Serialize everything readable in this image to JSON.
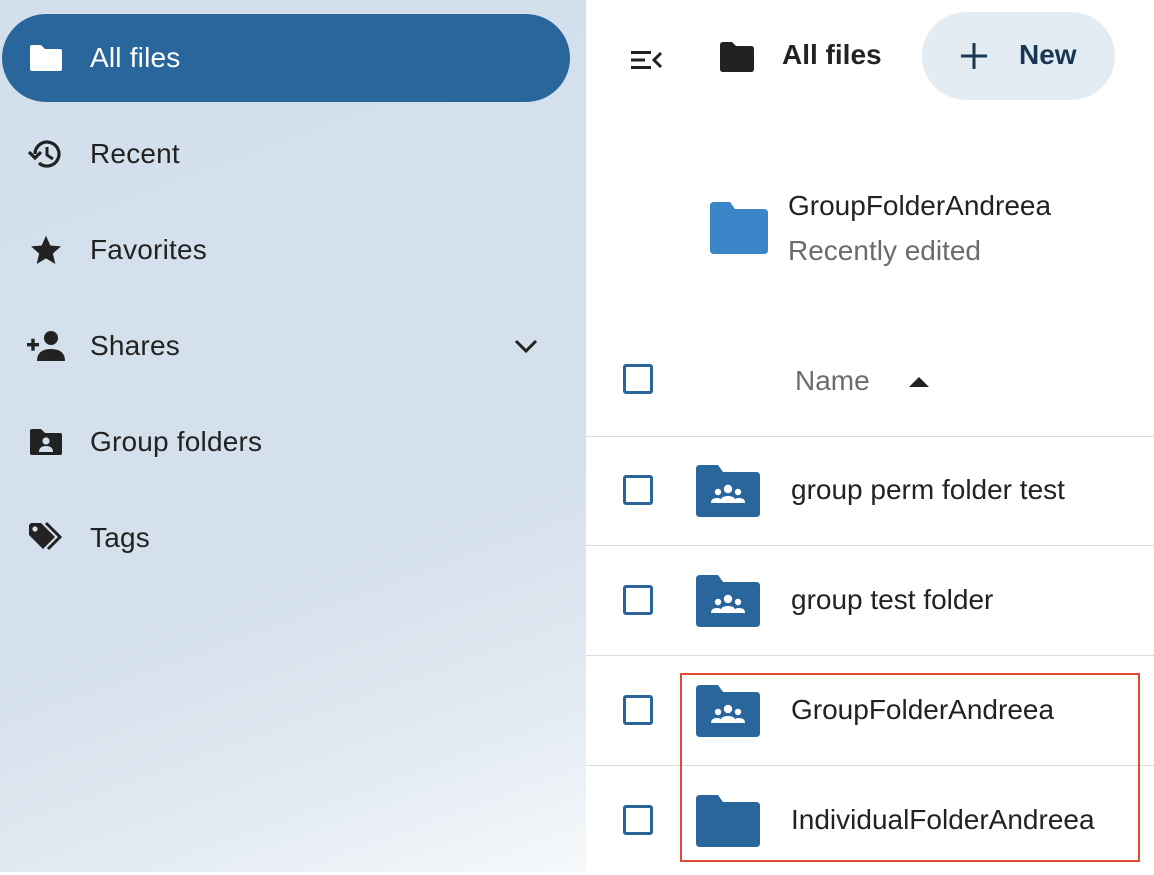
{
  "sidebar": {
    "items": [
      {
        "label": "All files",
        "icon": "folder-icon",
        "active": true
      },
      {
        "label": "Recent",
        "icon": "history-icon"
      },
      {
        "label": "Favorites",
        "icon": "star-icon"
      },
      {
        "label": "Shares",
        "icon": "share-person-icon",
        "expandable": true
      },
      {
        "label": "Group folders",
        "icon": "group-folder-icon"
      },
      {
        "label": "Tags",
        "icon": "tags-icon"
      }
    ]
  },
  "header": {
    "breadcrumb": "All files",
    "new_label": "New"
  },
  "recent": {
    "name": "GroupFolderAndreea",
    "subtitle": "Recently edited"
  },
  "table": {
    "column_name": "Name",
    "sort": "ascending",
    "rows": [
      {
        "name": "group perm folder test",
        "type": "group-folder"
      },
      {
        "name": "group test folder",
        "type": "group-folder"
      },
      {
        "name": "GroupFolderAndreea",
        "type": "group-folder"
      },
      {
        "name": "IndividualFolderAndreea",
        "type": "folder"
      }
    ]
  },
  "colors": {
    "accent": "#29669b",
    "sidebar_bg": "#d4e0ec",
    "new_button_bg": "#e3ebf3",
    "highlight": "#e24a33",
    "recent_folder": "#3a86c8"
  }
}
